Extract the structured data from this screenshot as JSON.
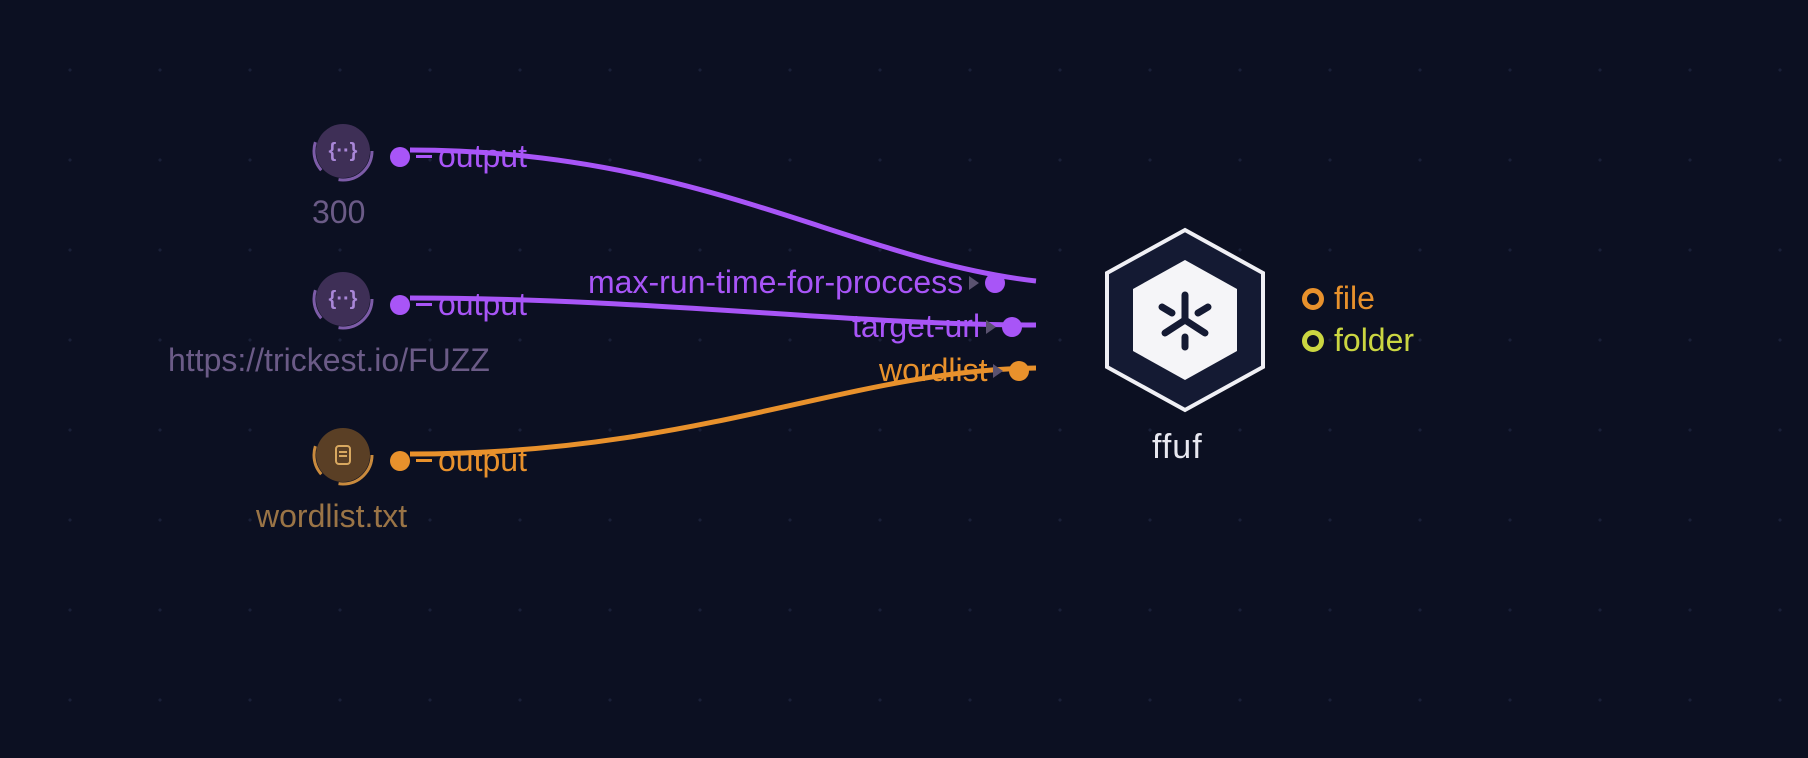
{
  "nodes": {
    "n1": {
      "label": "300",
      "output": "output"
    },
    "n2": {
      "label": "https://trickest.io/FUZZ",
      "output": "output"
    },
    "n3": {
      "label": "wordlist.txt",
      "output": "output"
    }
  },
  "target": {
    "name": "ffuf",
    "inputs": {
      "i1": "max-run-time-for-proccess",
      "i2": "target-url",
      "i3": "wordlist"
    },
    "outputs": {
      "file": "file",
      "folder": "folder"
    }
  }
}
